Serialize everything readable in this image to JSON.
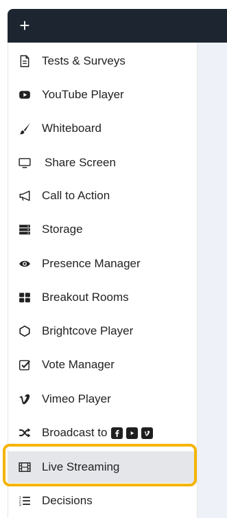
{
  "toolbar": {
    "add_label": "+"
  },
  "menu": {
    "items": [
      {
        "label": "Tests & Surveys",
        "icon": "document-icon"
      },
      {
        "label": "YouTube Player",
        "icon": "youtube-icon"
      },
      {
        "label": "Whiteboard",
        "icon": "paintbrush-icon"
      },
      {
        "label": "Share Screen",
        "icon": "monitor-icon"
      },
      {
        "label": "Call to Action",
        "icon": "megaphone-icon"
      },
      {
        "label": "Storage",
        "icon": "server-icon"
      },
      {
        "label": "Presence Manager",
        "icon": "eye-icon"
      },
      {
        "label": "Breakout Rooms",
        "icon": "grid-icon"
      },
      {
        "label": "Brightcove Player",
        "icon": "brightcove-icon"
      },
      {
        "label": "Vote Manager",
        "icon": "checkbox-icon"
      },
      {
        "label": "Vimeo Player",
        "icon": "vimeo-icon"
      },
      {
        "label": "Broadcast to",
        "icon": "random-icon"
      },
      {
        "label": "Live Streaming",
        "icon": "film-icon",
        "selected": true
      },
      {
        "label": "Decisions",
        "icon": "ordered-list-icon"
      }
    ]
  },
  "broadcast_targets": [
    "facebook-icon",
    "youtube-icon",
    "vimeo-icon"
  ],
  "colors": {
    "topbar": "#1d2530",
    "highlight": "#f5b400",
    "selected_bg": "#e4e6ea",
    "content_bg": "#eef1f7"
  }
}
